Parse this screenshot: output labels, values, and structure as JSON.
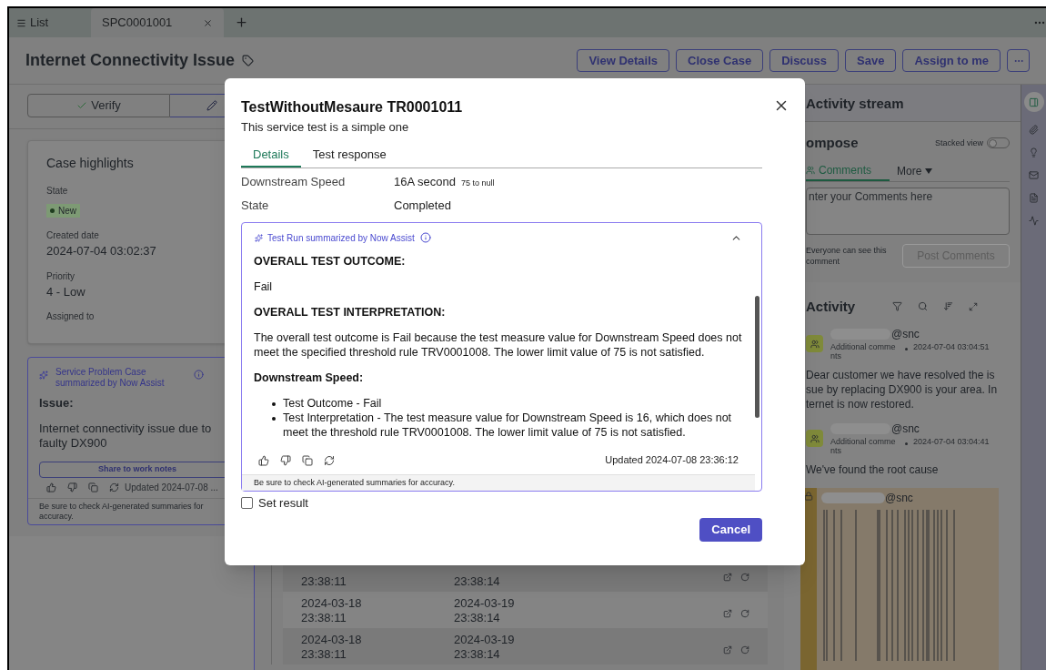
{
  "top_tabs": [
    {
      "label": "List",
      "kind": "list",
      "selected": false
    },
    {
      "label": "SPC0001001",
      "kind": "record",
      "selected": true
    }
  ],
  "record": {
    "title": "Internet Connectivity Issue",
    "actions": [
      "View Details",
      "Close Case",
      "Discuss",
      "Save",
      "Assign to me"
    ]
  },
  "stepper": [
    {
      "kind": "done",
      "label": "Verify"
    },
    {
      "kind": "current"
    }
  ],
  "case_highlights": {
    "title": "Case highlights",
    "fields": [
      {
        "label": "State",
        "value": "New",
        "kind": "badge"
      },
      {
        "label": "Created date",
        "value": "2024-07-04 03:02:37",
        "kind": "text"
      },
      {
        "label": "Priority",
        "value": "4 - Low",
        "kind": "text"
      },
      {
        "label": "Assigned to",
        "kind": "empty"
      }
    ]
  },
  "case_summary": {
    "title": "Service Problem Case summarized by Now Assist",
    "heading": "Issue:",
    "text": "Internet connectivity issue due to faulty DX900",
    "share_button": "Share to work notes",
    "updated": "Updated 2024-07-08 ...",
    "disclaimer": "Be sure to check AI-generated summaries for accuracy."
  },
  "test_runs_table": {
    "rows": [
      {
        "started": "23:38:11",
        "ended": "23:38:14"
      },
      {
        "started": "2024-03-18 23:38:11",
        "ended": "2024-03-19 23:38:14"
      },
      {
        "started": "2024-03-18 23:38:11",
        "ended": "2024-03-19 23:38:14"
      }
    ]
  },
  "modal": {
    "title": "TestWithoutMesaure TR0001011",
    "subtitle": "This service test is a simple one",
    "tabs": [
      {
        "label": "Details",
        "selected": true
      },
      {
        "label": "Test response",
        "selected": false
      }
    ],
    "fields": [
      {
        "label": "Downstream Speed",
        "value": "16A second",
        "note": "75 to null"
      },
      {
        "label": "State",
        "value": "Completed"
      }
    ],
    "summary": {
      "title": "Test Run summarized by Now Assist",
      "expanded": true,
      "blocks": [
        {
          "kind": "heading",
          "text": "OVERALL TEST OUTCOME:"
        },
        {
          "kind": "paragraph",
          "text": "Fail"
        },
        {
          "kind": "heading",
          "text": "OVERALL TEST INTERPRETATION:"
        },
        {
          "kind": "paragraph",
          "text": "The overall test outcome is Fail because the test measure value for Downstream Speed does not meet the specified threshold rule TRV0001008. The lower limit value of 75 is not satisfied."
        },
        {
          "kind": "heading",
          "text": "Downstream Speed:"
        },
        {
          "kind": "bullets",
          "items": [
            "Test Outcome - Fail",
            "Test Interpretation - The test measure value for Downstream Speed is 16, which does not meet the threshold rule TRV0001008. The lower limit value of 75 is not satisfied."
          ]
        }
      ],
      "updated": "Updated 2024-07-08 23:36:12",
      "disclaimer": "Be sure to check AI-generated summaries for accuracy."
    },
    "set_result": {
      "label": "Set result",
      "checked": false
    },
    "cancel_button": "Cancel"
  },
  "activity_stream": {
    "title": "Activity stream",
    "compose": {
      "title": "ompose",
      "stacked_view": {
        "label": "Stacked view",
        "on": false
      },
      "tabs": [
        {
          "label": "Comments",
          "selected": true
        },
        {
          "label": "More",
          "selected": false
        }
      ],
      "placeholder": "nter your Comments here",
      "visibility_note": "Everyone can see this comment",
      "post_button": {
        "label": "Post Comments",
        "disabled": true
      }
    },
    "activity": {
      "title": "Activity",
      "entries": [
        {
          "kind": "comment",
          "author": "@snc",
          "type": "Additional comments",
          "time": "2024-07-04 03:04:51",
          "text": "Dear customer we have resolved the issue by replacing DX900 is your area. Internet is now restored."
        },
        {
          "kind": "comment",
          "author": "@snc",
          "type": "Additional comments",
          "time": "2024-07-04 03:04:41",
          "text": "We've found the root cause"
        },
        {
          "kind": "work_note",
          "author": "@snc"
        }
      ]
    }
  }
}
